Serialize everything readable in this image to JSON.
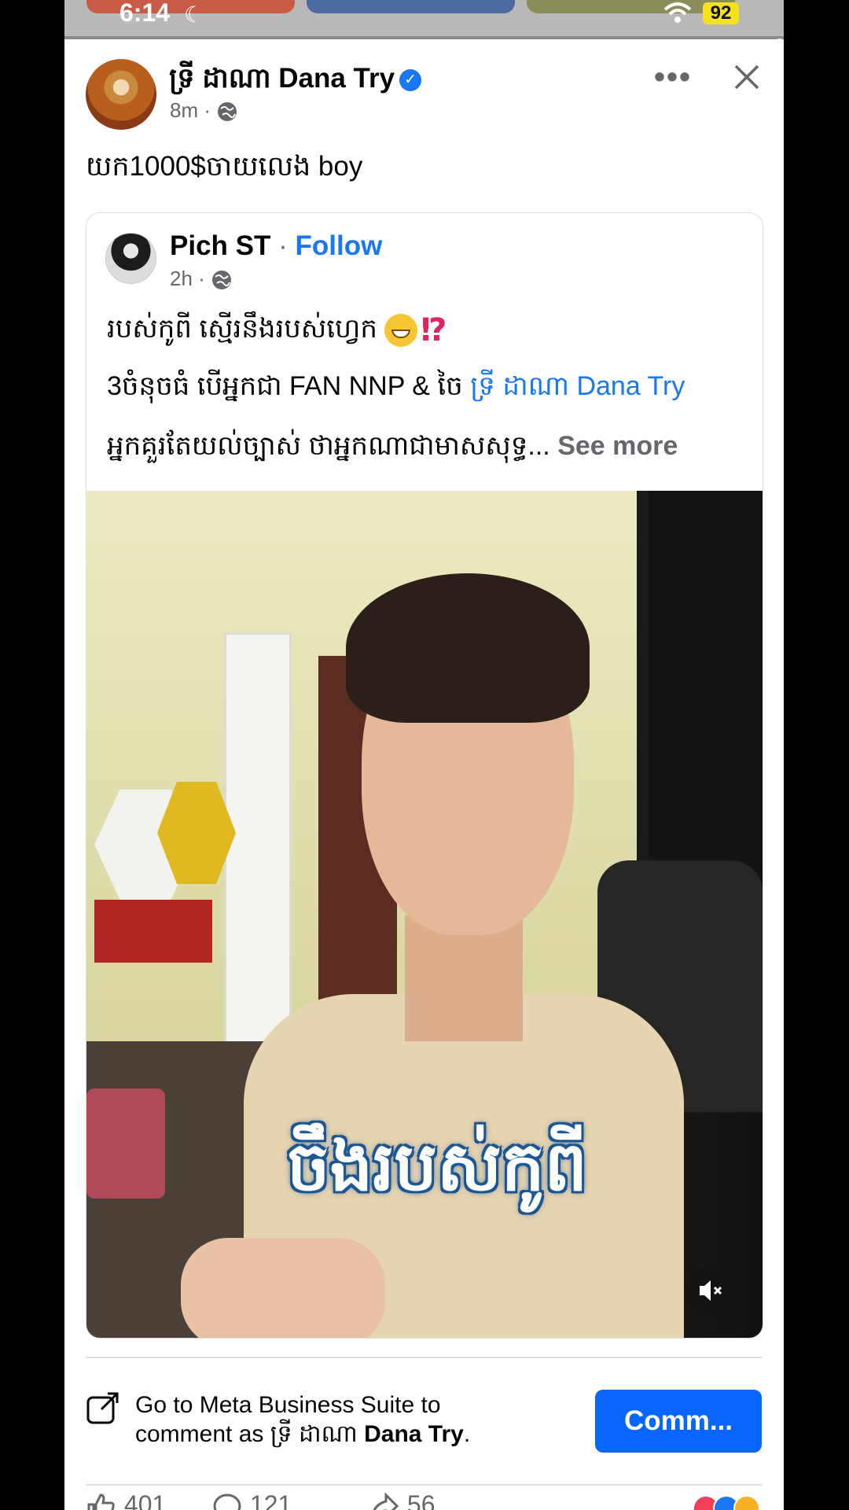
{
  "status_bar": {
    "time": "6:14",
    "battery": "92"
  },
  "post": {
    "author": "ទ្រី ដាណា Dana Try",
    "time": "8m",
    "caption": "យក1000$ចាយលេង boy"
  },
  "shared_post": {
    "author": "Pich ST",
    "follow_label": "Follow",
    "separator": "·",
    "time": "2h",
    "line1": "របស់កូពី ស្មើរនឹងរបស់ហ្វេក",
    "line2_prefix": "3ចំនុចធំ បើអ្នកជា FAN NNP & ចៃ ",
    "line2_link": "ទ្រី ដាណា Dana Try",
    "line3": "អ្នកគួរតែយល់ច្បាស់ ថាអ្នកណាជាមាសសុទ្ធ...",
    "see_more": "See more"
  },
  "video": {
    "caption": "ចឹងរបស់កូពី",
    "muted": true
  },
  "comment_bar": {
    "text_prefix": "Go to Meta Business Suite to",
    "text_second": "comment as ទ្រី ដាណា ",
    "text_bold": "Dana Try",
    "text_suffix": ".",
    "button_label": "Comm..."
  },
  "reactions": {
    "likes": "401",
    "comments": "121",
    "shares": "56"
  },
  "colors": {
    "link_blue": "#1877f2",
    "button_blue": "#0866ff",
    "battery_yellow": "#f5e21a"
  }
}
